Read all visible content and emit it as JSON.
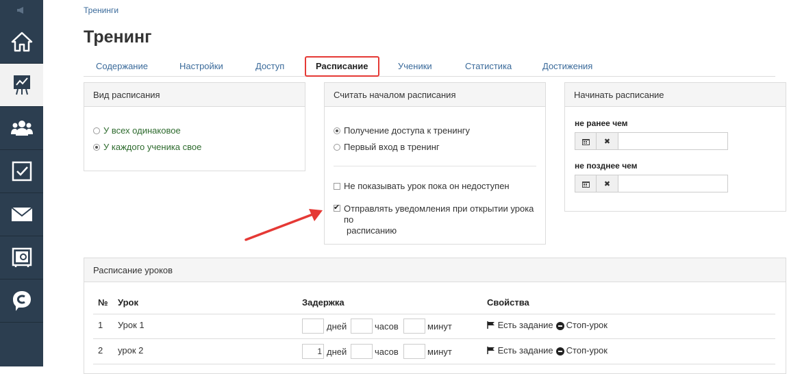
{
  "breadcrumb": "Тренинги",
  "page_title": "Тренинг",
  "tabs": [
    "Содержание",
    "Настройки",
    "Доступ",
    "Расписание",
    "Ученики",
    "Статистика",
    "Достижения"
  ],
  "active_tab": "Расписание",
  "schedule_type": {
    "title": "Вид расписания",
    "options": [
      "У всех одинаковое",
      "У каждого ученика свое"
    ],
    "selected": "У каждого ученика свое"
  },
  "schedule_start": {
    "title": "Считать началом расписания",
    "options": [
      "Получение доступа к тренингу",
      "Первый вход в тренинг"
    ],
    "selected": "Получение доступа к тренингу",
    "checkboxes": [
      {
        "label": "Не показывать урок пока он недоступен",
        "checked": false
      },
      {
        "label_line1": "Отправлять уведомления при открытии урока по",
        "label_line2": "расписанию",
        "checked": true
      }
    ]
  },
  "begin_schedule": {
    "title": "Начинать расписание",
    "not_earlier_label": "не ранее чем",
    "not_later_label": "не позднее чем"
  },
  "lessons": {
    "title": "Расписание уроков",
    "headers": {
      "num": "№",
      "lesson": "Урок",
      "delay": "Задержка",
      "props": "Свойства"
    },
    "units": {
      "days": "дней",
      "hours": "часов",
      "minutes": "минут"
    },
    "rows": [
      {
        "num": "1",
        "name": "Урок 1",
        "days": "",
        "hours": "",
        "minutes": "",
        "task": "Есть задание",
        "stop": "Стоп-урок"
      },
      {
        "num": "2",
        "name": "урок 2",
        "days": "1",
        "hours": "",
        "minutes": "",
        "task": "Есть задание",
        "stop": "Стоп-урок"
      }
    ]
  },
  "annotation": {
    "color": "#e53935"
  },
  "sidebar_icons": [
    "megaphone-icon",
    "home-icon",
    "chart-icon",
    "users-icon",
    "tasks-icon",
    "mail-icon",
    "safe-icon",
    "chat-icon"
  ]
}
